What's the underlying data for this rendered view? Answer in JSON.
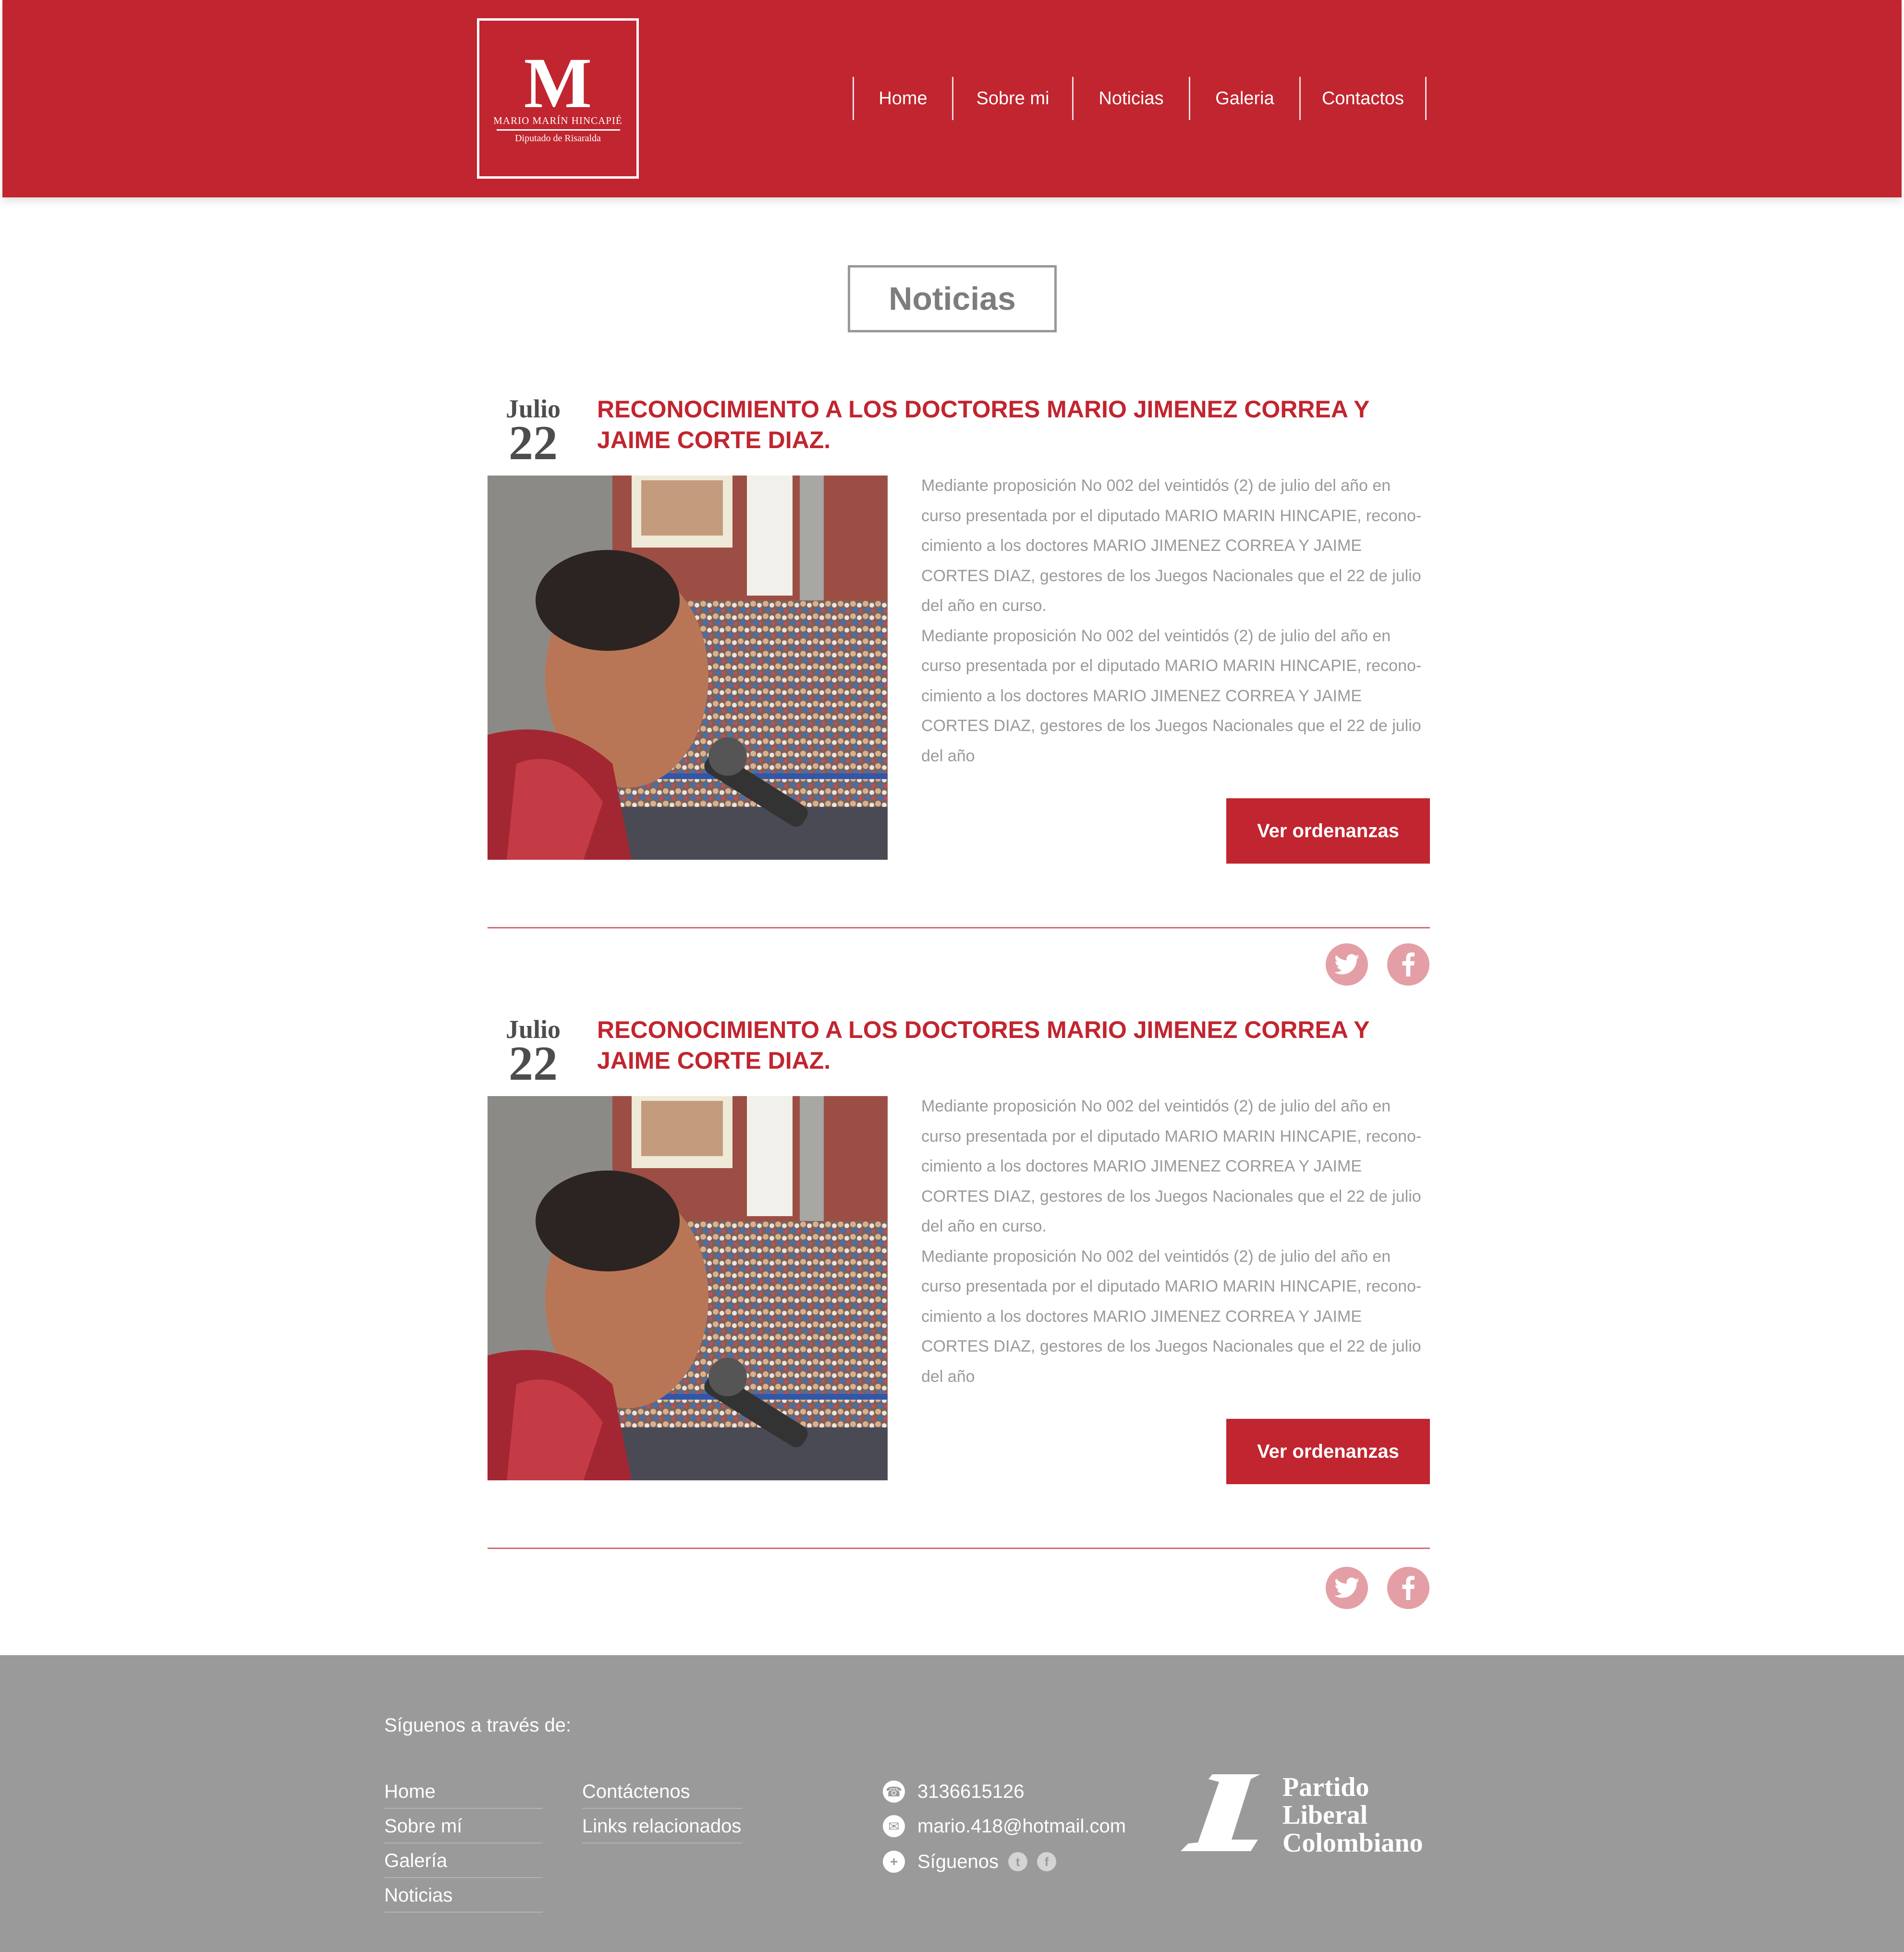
{
  "header": {
    "logo": {
      "letter": "M",
      "name": "MARIO MARÍN HINCAPIÉ",
      "subtitle": "Diputado de Risaralda"
    },
    "nav": [
      "Home",
      "Sobre mi",
      "Noticias",
      "Galeria",
      "Contactos"
    ]
  },
  "section_title": "Noticias",
  "articles": [
    {
      "month": "Julio",
      "day": "22",
      "title": "RECONOCIMIENTO A LOS DOCTORES MARIO JIMENEZ CORREA Y JAIME CORTE DIAZ.",
      "paragraph1": "Mediante proposición No 002 del veintidós (2) de julio del año en curso presentada por el diputado MARIO MARIN HINCAPIE, recono-cimiento a los doctores MARIO JIMENEZ CORREA Y JAIME CORTES DIAZ, gestores de los Juegos Nacionales que el 22 de julio del año en curso.",
      "paragraph2": "Mediante proposición No 002 del veintidós (2) de julio del año en curso presentada por el diputado MARIO MARIN HINCAPIE, recono-cimiento a los doctores MARIO JIMENEZ CORREA Y JAIME CORTES DIAZ, gestores de los Juegos Nacionales que el 22 de julio del año",
      "button": "Ver ordenanzas"
    },
    {
      "month": "Julio",
      "day": "22",
      "title": "RECONOCIMIENTO A LOS DOCTORES MARIO JIMENEZ CORREA Y JAIME CORTE DIAZ.",
      "paragraph1": "Mediante proposición No 002 del veintidós (2) de julio del año en curso presentada por el diputado MARIO MARIN HINCAPIE, recono-cimiento a los doctores MARIO JIMENEZ CORREA Y JAIME CORTES DIAZ, gestores de los Juegos Nacionales que el 22 de julio del año en curso.",
      "paragraph2": "Mediante proposición No 002 del veintidós (2) de julio del año en curso presentada por el diputado MARIO MARIN HINCAPIE, recono-cimiento a los doctores MARIO JIMENEZ CORREA Y JAIME CORTES DIAZ, gestores de los Juegos Nacionales que el 22 de julio del año",
      "button": "Ver ordenanzas"
    }
  ],
  "footer": {
    "follow_title": "Síguenos a través de:",
    "links_col1": [
      "Home",
      "Sobre mí",
      "Galería",
      "Noticias"
    ],
    "links_col2": [
      "Contáctenos",
      "Links relacionados"
    ],
    "phone": "3136615126",
    "email": "mario.418@hotmail.com",
    "follow": "Síguenos",
    "party": [
      "Partido",
      "Liberal",
      "Colombiano"
    ]
  },
  "colors": {
    "brand_red": "#c1252f",
    "footer_gray": "#9a9a9a",
    "social_pink": "#e39fa5"
  },
  "icons": [
    "twitter-icon",
    "facebook-icon",
    "phone-icon",
    "mail-icon",
    "plus-icon"
  ]
}
